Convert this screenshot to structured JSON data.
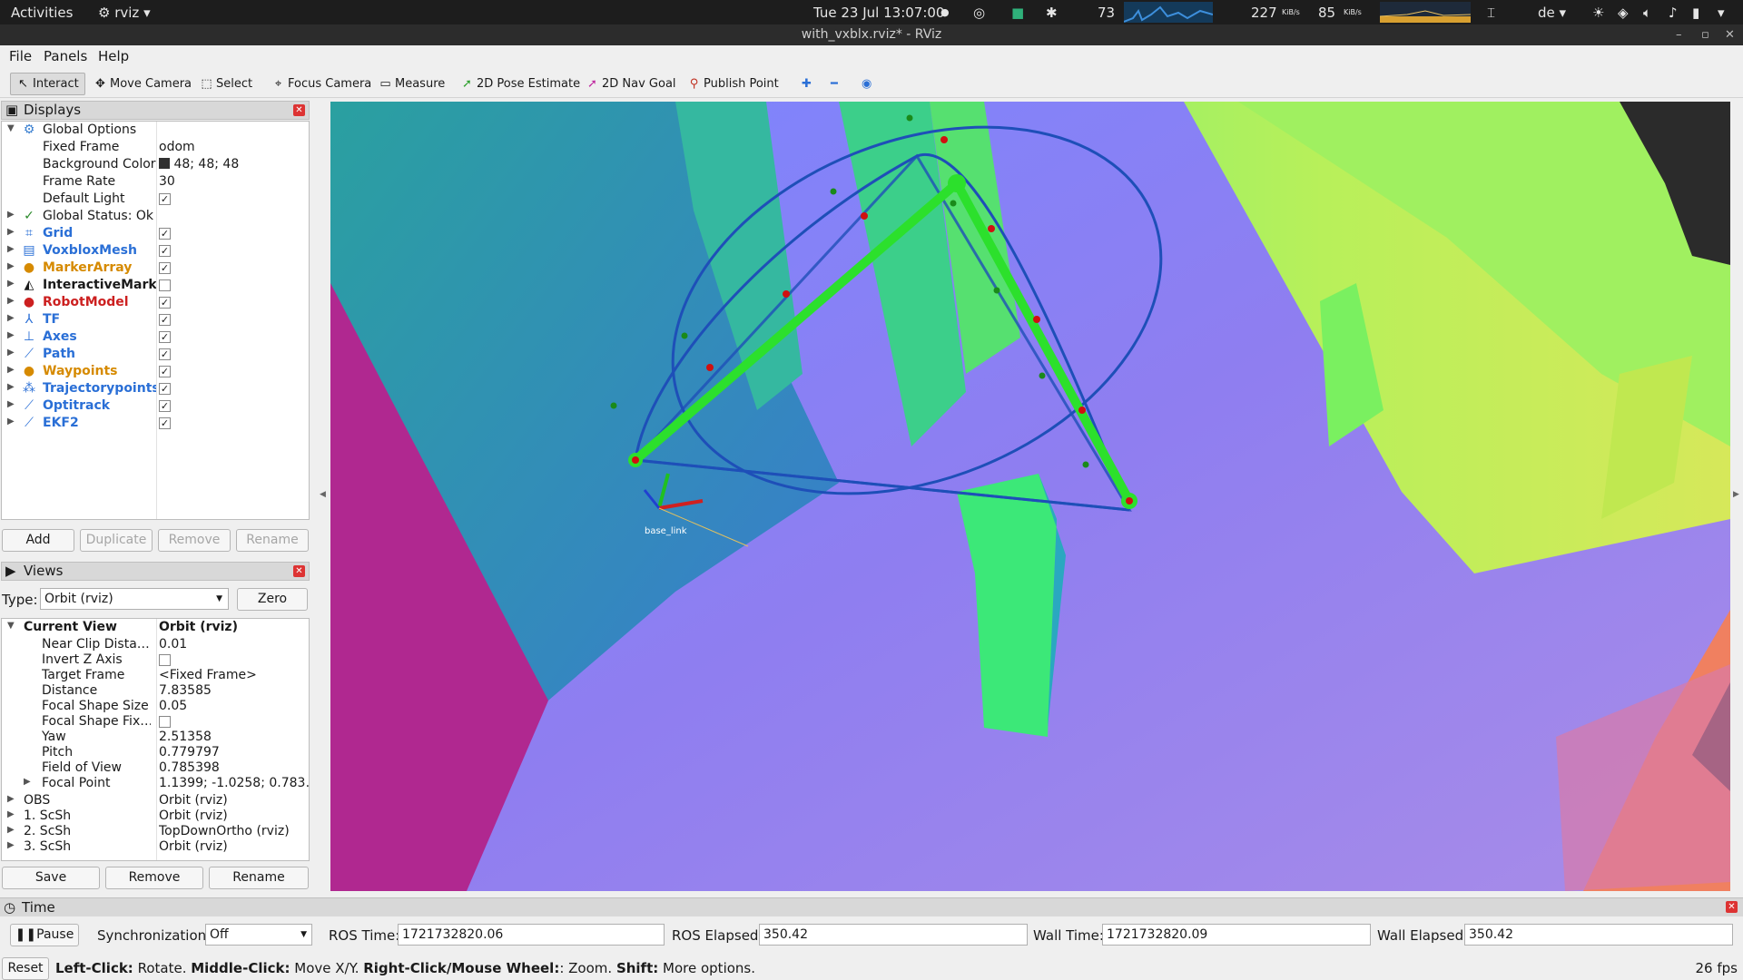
{
  "topbar": {
    "activities": "Activities",
    "app": "rviz",
    "datetime": "Tue 23 Jul  13:07:00",
    "cpu": "73",
    "net_down": "227",
    "net_down_unit": "KiB/s",
    "net_up": "85",
    "net_up_unit": "KiB/s",
    "keyboard": "de"
  },
  "window": {
    "title": "with_vxblx.rviz* - RViz"
  },
  "menu": {
    "file": "File",
    "panels": "Panels",
    "help": "Help"
  },
  "toolbar": {
    "interact": "Interact",
    "move_camera": "Move Camera",
    "select": "Select",
    "focus_camera": "Focus Camera",
    "measure": "Measure",
    "pose_estimate": "2D Pose Estimate",
    "nav_goal": "2D Nav Goal",
    "publish_point": "Publish Point"
  },
  "displays": {
    "title": "Displays",
    "global_options": "Global Options",
    "fixed_frame_label": "Fixed Frame",
    "fixed_frame": "odom",
    "bg_color_label": "Background Color",
    "bg_color": "48; 48; 48",
    "bg_color_hex": "#303030",
    "frame_rate_label": "Frame Rate",
    "frame_rate": "30",
    "default_light_label": "Default Light",
    "global_status": "Global Status: Ok",
    "items": [
      {
        "label": "Grid",
        "color": "#2a6fd6",
        "checked": true
      },
      {
        "label": "VoxbloxMesh",
        "color": "#2a6fd6",
        "checked": true
      },
      {
        "label": "MarkerArray",
        "color": "#d68a00",
        "checked": true
      },
      {
        "label": "InteractiveMark…",
        "color": "#1a1a1a",
        "checked": false
      },
      {
        "label": "RobotModel",
        "color": "#cc2020",
        "checked": true
      },
      {
        "label": "TF",
        "color": "#2a6fd6",
        "checked": true
      },
      {
        "label": "Axes",
        "color": "#2a6fd6",
        "checked": true
      },
      {
        "label": "Path",
        "color": "#2a6fd6",
        "checked": true
      },
      {
        "label": "Waypoints",
        "color": "#d68a00",
        "checked": true
      },
      {
        "label": "Trajectorypoints",
        "color": "#2a6fd6",
        "checked": true
      },
      {
        "label": "Optitrack",
        "color": "#2a6fd6",
        "checked": true
      },
      {
        "label": "EKF2",
        "color": "#2a6fd6",
        "checked": true
      }
    ],
    "add": "Add",
    "duplicate": "Duplicate",
    "remove": "Remove",
    "rename": "Rename"
  },
  "views": {
    "title": "Views",
    "type_label": "Type:",
    "type_value": "Orbit (rviz)",
    "zero": "Zero",
    "current_view": "Current View",
    "current_view_value": "Orbit (rviz)",
    "props": [
      {
        "label": "Near Clip Dista…",
        "value": "0.01"
      },
      {
        "label": "Invert Z Axis",
        "value": ""
      },
      {
        "label": "Target Frame",
        "value": "<Fixed Frame>"
      },
      {
        "label": "Distance",
        "value": "7.83585"
      },
      {
        "label": "Focal Shape Size",
        "value": "0.05"
      },
      {
        "label": "Focal Shape Fix…",
        "value": ""
      },
      {
        "label": "Yaw",
        "value": "2.51358"
      },
      {
        "label": "Pitch",
        "value": "0.779797"
      },
      {
        "label": "Field of View",
        "value": "0.785398"
      },
      {
        "label": "Focal Point",
        "value": "1.1399; -1.0258; 0.783…"
      }
    ],
    "saved": [
      {
        "label": "OBS",
        "value": "Orbit (rviz)"
      },
      {
        "label": "1. ScSh",
        "value": "Orbit (rviz)"
      },
      {
        "label": "2. ScSh",
        "value": "TopDownOrtho (rviz)"
      },
      {
        "label": "3. ScSh",
        "value": "Orbit (rviz)"
      }
    ],
    "save": "Save",
    "remove": "Remove",
    "rename": "Rename"
  },
  "viewport": {
    "frame_label": "base_link"
  },
  "time": {
    "title": "Time",
    "pause": "Pause",
    "sync_label": "Synchronization:",
    "sync_value": "Off",
    "ros_time_label": "ROS Time:",
    "ros_time": "1721732820.06",
    "ros_elapsed_label": "ROS Elapsed:",
    "ros_elapsed": "350.42",
    "wall_time_label": "Wall Time:",
    "wall_time": "1721732820.09",
    "wall_elapsed_label": "Wall Elapsed:",
    "wall_elapsed": "350.42"
  },
  "status": {
    "reset": "Reset",
    "left_click": "Left-Click:",
    "left_click_action": " Rotate. ",
    "middle_click": "Middle-Click:",
    "middle_click_action": " Move X/Y. ",
    "right_click": "Right-Click/Mouse Wheel:",
    "right_click_action": ": Zoom. ",
    "shift": "Shift:",
    "shift_action": " More options.",
    "fps": "26 fps"
  }
}
